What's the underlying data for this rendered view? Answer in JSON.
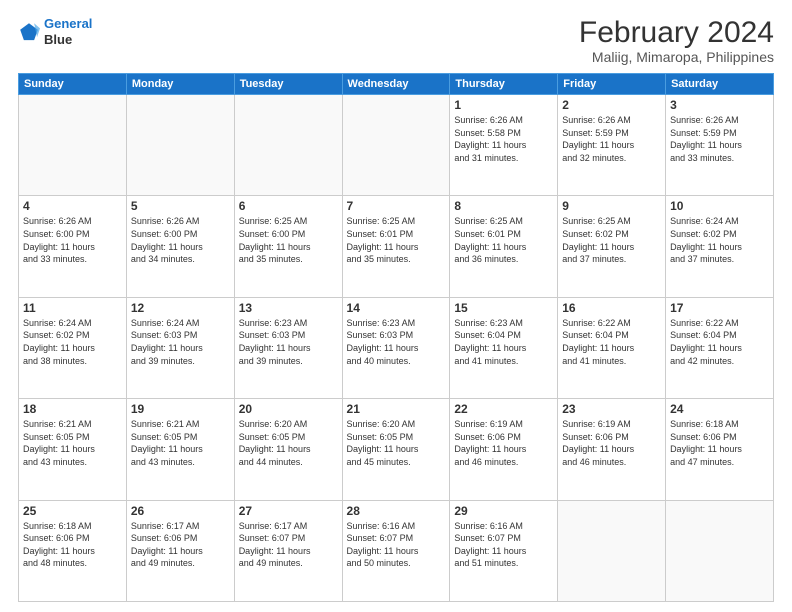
{
  "logo": {
    "line1": "General",
    "line2": "Blue"
  },
  "title": "February 2024",
  "subtitle": "Maliig, Mimaropa, Philippines",
  "days_of_week": [
    "Sunday",
    "Monday",
    "Tuesday",
    "Wednesday",
    "Thursday",
    "Friday",
    "Saturday"
  ],
  "weeks": [
    [
      {
        "day": "",
        "info": ""
      },
      {
        "day": "",
        "info": ""
      },
      {
        "day": "",
        "info": ""
      },
      {
        "day": "",
        "info": ""
      },
      {
        "day": "1",
        "info": "Sunrise: 6:26 AM\nSunset: 5:58 PM\nDaylight: 11 hours\nand 31 minutes."
      },
      {
        "day": "2",
        "info": "Sunrise: 6:26 AM\nSunset: 5:59 PM\nDaylight: 11 hours\nand 32 minutes."
      },
      {
        "day": "3",
        "info": "Sunrise: 6:26 AM\nSunset: 5:59 PM\nDaylight: 11 hours\nand 33 minutes."
      }
    ],
    [
      {
        "day": "4",
        "info": "Sunrise: 6:26 AM\nSunset: 6:00 PM\nDaylight: 11 hours\nand 33 minutes."
      },
      {
        "day": "5",
        "info": "Sunrise: 6:26 AM\nSunset: 6:00 PM\nDaylight: 11 hours\nand 34 minutes."
      },
      {
        "day": "6",
        "info": "Sunrise: 6:25 AM\nSunset: 6:00 PM\nDaylight: 11 hours\nand 35 minutes."
      },
      {
        "day": "7",
        "info": "Sunrise: 6:25 AM\nSunset: 6:01 PM\nDaylight: 11 hours\nand 35 minutes."
      },
      {
        "day": "8",
        "info": "Sunrise: 6:25 AM\nSunset: 6:01 PM\nDaylight: 11 hours\nand 36 minutes."
      },
      {
        "day": "9",
        "info": "Sunrise: 6:25 AM\nSunset: 6:02 PM\nDaylight: 11 hours\nand 37 minutes."
      },
      {
        "day": "10",
        "info": "Sunrise: 6:24 AM\nSunset: 6:02 PM\nDaylight: 11 hours\nand 37 minutes."
      }
    ],
    [
      {
        "day": "11",
        "info": "Sunrise: 6:24 AM\nSunset: 6:02 PM\nDaylight: 11 hours\nand 38 minutes."
      },
      {
        "day": "12",
        "info": "Sunrise: 6:24 AM\nSunset: 6:03 PM\nDaylight: 11 hours\nand 39 minutes."
      },
      {
        "day": "13",
        "info": "Sunrise: 6:23 AM\nSunset: 6:03 PM\nDaylight: 11 hours\nand 39 minutes."
      },
      {
        "day": "14",
        "info": "Sunrise: 6:23 AM\nSunset: 6:03 PM\nDaylight: 11 hours\nand 40 minutes."
      },
      {
        "day": "15",
        "info": "Sunrise: 6:23 AM\nSunset: 6:04 PM\nDaylight: 11 hours\nand 41 minutes."
      },
      {
        "day": "16",
        "info": "Sunrise: 6:22 AM\nSunset: 6:04 PM\nDaylight: 11 hours\nand 41 minutes."
      },
      {
        "day": "17",
        "info": "Sunrise: 6:22 AM\nSunset: 6:04 PM\nDaylight: 11 hours\nand 42 minutes."
      }
    ],
    [
      {
        "day": "18",
        "info": "Sunrise: 6:21 AM\nSunset: 6:05 PM\nDaylight: 11 hours\nand 43 minutes."
      },
      {
        "day": "19",
        "info": "Sunrise: 6:21 AM\nSunset: 6:05 PM\nDaylight: 11 hours\nand 43 minutes."
      },
      {
        "day": "20",
        "info": "Sunrise: 6:20 AM\nSunset: 6:05 PM\nDaylight: 11 hours\nand 44 minutes."
      },
      {
        "day": "21",
        "info": "Sunrise: 6:20 AM\nSunset: 6:05 PM\nDaylight: 11 hours\nand 45 minutes."
      },
      {
        "day": "22",
        "info": "Sunrise: 6:19 AM\nSunset: 6:06 PM\nDaylight: 11 hours\nand 46 minutes."
      },
      {
        "day": "23",
        "info": "Sunrise: 6:19 AM\nSunset: 6:06 PM\nDaylight: 11 hours\nand 46 minutes."
      },
      {
        "day": "24",
        "info": "Sunrise: 6:18 AM\nSunset: 6:06 PM\nDaylight: 11 hours\nand 47 minutes."
      }
    ],
    [
      {
        "day": "25",
        "info": "Sunrise: 6:18 AM\nSunset: 6:06 PM\nDaylight: 11 hours\nand 48 minutes."
      },
      {
        "day": "26",
        "info": "Sunrise: 6:17 AM\nSunset: 6:06 PM\nDaylight: 11 hours\nand 49 minutes."
      },
      {
        "day": "27",
        "info": "Sunrise: 6:17 AM\nSunset: 6:07 PM\nDaylight: 11 hours\nand 49 minutes."
      },
      {
        "day": "28",
        "info": "Sunrise: 6:16 AM\nSunset: 6:07 PM\nDaylight: 11 hours\nand 50 minutes."
      },
      {
        "day": "29",
        "info": "Sunrise: 6:16 AM\nSunset: 6:07 PM\nDaylight: 11 hours\nand 51 minutes."
      },
      {
        "day": "",
        "info": ""
      },
      {
        "day": "",
        "info": ""
      }
    ]
  ]
}
